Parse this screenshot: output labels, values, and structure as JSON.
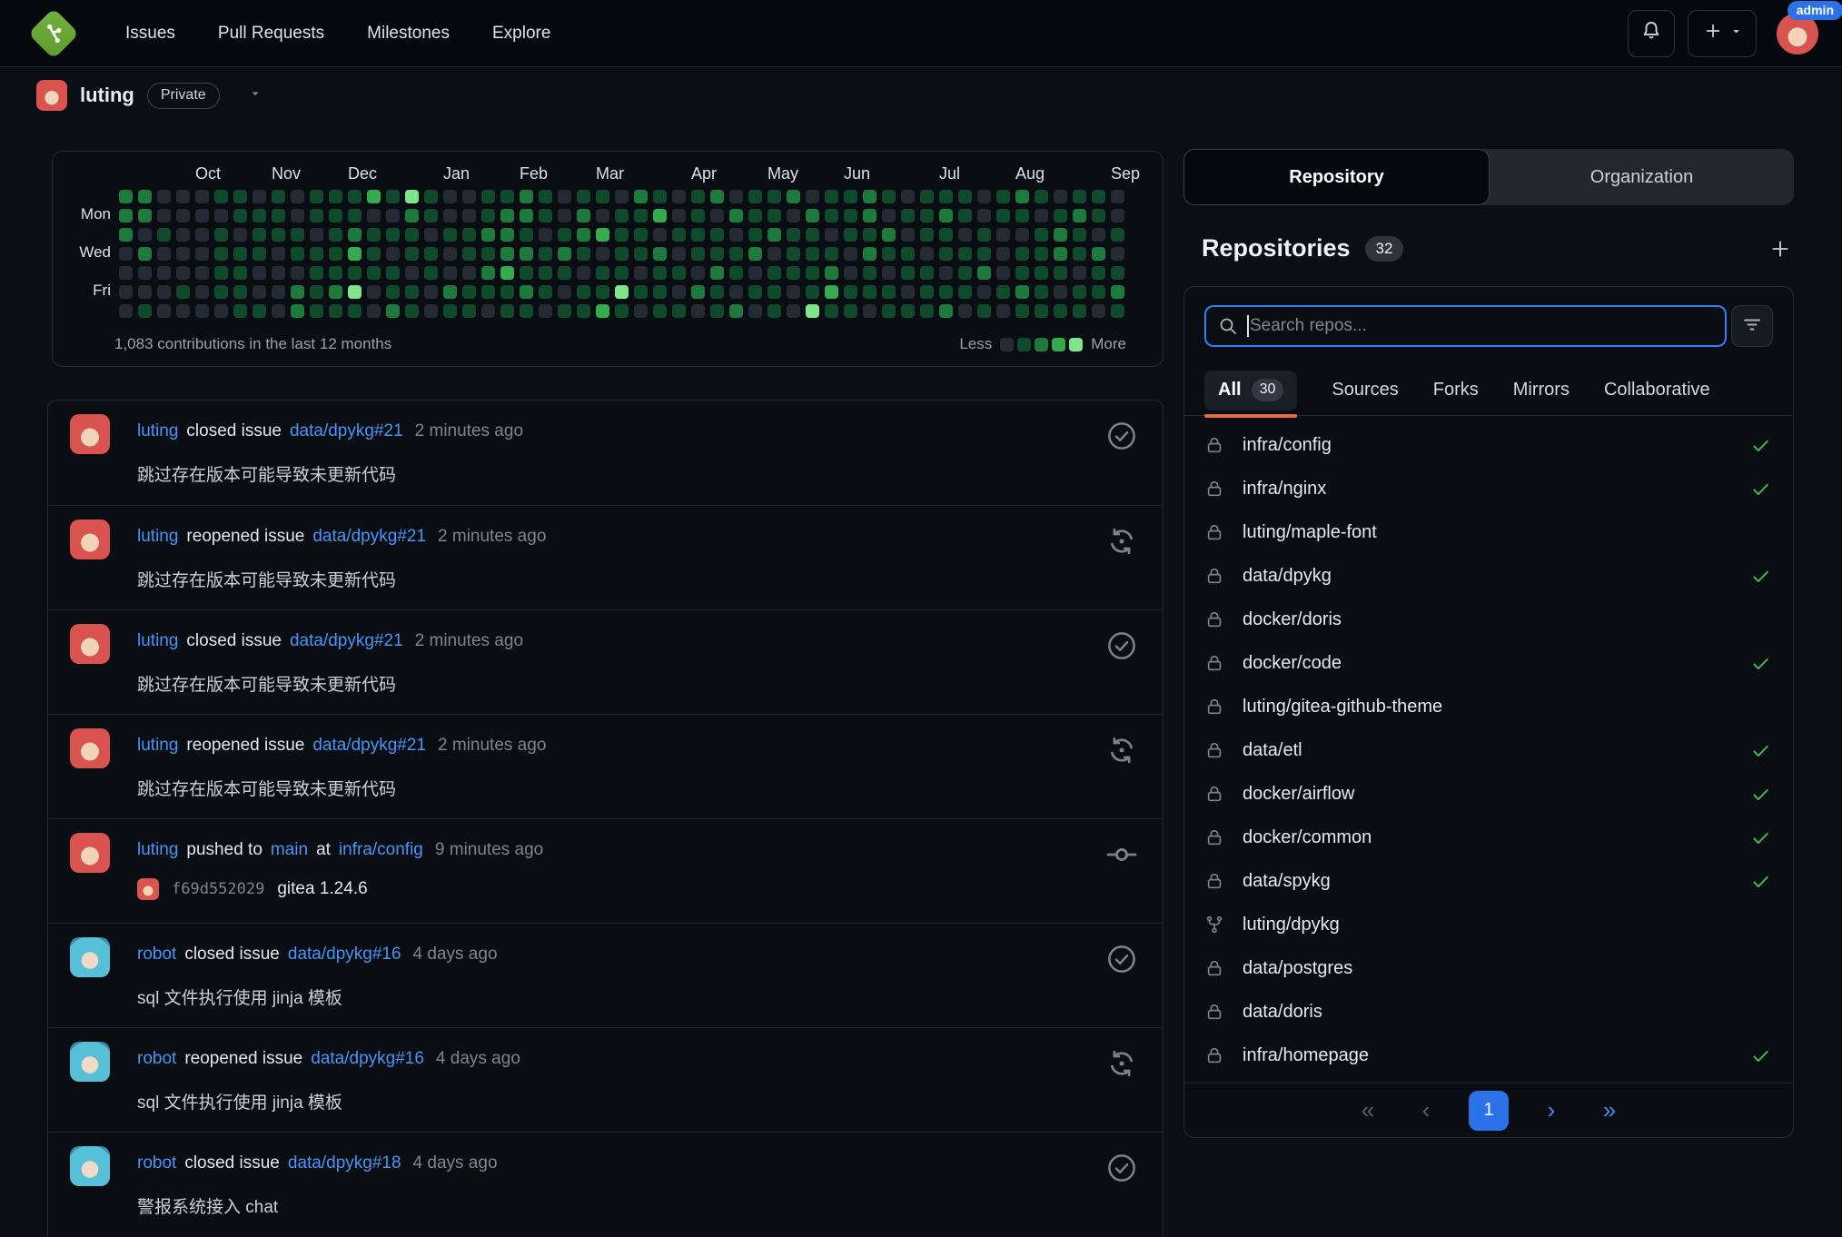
{
  "colors": {
    "accent_blue": "#4795f8",
    "active_page_blue": "#2b72e8",
    "check_green": "#3db954",
    "filter_underline": "#e5674e",
    "admin_badge_blue": "#2b72e8",
    "search_border_blue": "#2f81f7",
    "logo_green": "#68a63d",
    "heatmap_levels": [
      "#252b34",
      "#0f4a2c",
      "#1d7a3c",
      "#34ab4e",
      "#7ee58b"
    ]
  },
  "navbar": {
    "links": [
      "Issues",
      "Pull Requests",
      "Milestones",
      "Explore"
    ],
    "admin_badge": "admin",
    "icons": [
      "gitea-logo",
      "bell-icon",
      "plus-icon",
      "caret-down-icon",
      "avatar"
    ]
  },
  "profile": {
    "username": "luting",
    "visibility_badge": "Private"
  },
  "heatmap": {
    "contributions_text": "1,083 contributions in the last 12 months",
    "less_label": "Less",
    "more_label": "More",
    "day_labels": [
      {
        "label": "Mon",
        "row": 1
      },
      {
        "label": "Wed",
        "row": 3
      },
      {
        "label": "Fri",
        "row": 5
      }
    ],
    "months": [
      {
        "label": "Oct",
        "col": 4
      },
      {
        "label": "Nov",
        "col": 8
      },
      {
        "label": "Dec",
        "col": 12
      },
      {
        "label": "Jan",
        "col": 17
      },
      {
        "label": "Feb",
        "col": 21
      },
      {
        "label": "Mar",
        "col": 25
      },
      {
        "label": "Apr",
        "col": 30
      },
      {
        "label": "May",
        "col": 34
      },
      {
        "label": "Jun",
        "col": 38
      },
      {
        "label": "Jul",
        "col": 43
      },
      {
        "label": "Aug",
        "col": 47
      },
      {
        "label": "Sep",
        "col": 52
      }
    ],
    "rows": [
      "22000110101113141001121011021012011201121011101210110",
      "22000011101110021001221020113010211021120112101101210",
      "20100101110121110112210123110111012110112011010012101",
      "02000111011131011011221210112011120111021101110112120",
      "00000110001111101002311101101102101112010110120111011",
      "00010110021240110211121011411021011013111011101210112",
      "01000011021110210110110113101101201041101112010111101"
    ]
  },
  "feed": {
    "items": [
      {
        "user": "luting",
        "avatar": "luting",
        "action": "closed issue",
        "repo": "data/dpykg#21",
        "time": "2 minutes ago",
        "comment": "跳过存在版本可能导致未更新代码",
        "icon": "issue-closed"
      },
      {
        "user": "luting",
        "avatar": "luting",
        "action": "reopened issue",
        "repo": "data/dpykg#21",
        "time": "2 minutes ago",
        "comment": "跳过存在版本可能导致未更新代码",
        "icon": "issue-reopened"
      },
      {
        "user": "luting",
        "avatar": "luting",
        "action": "closed issue",
        "repo": "data/dpykg#21",
        "time": "2 minutes ago",
        "comment": "跳过存在版本可能导致未更新代码",
        "icon": "issue-closed"
      },
      {
        "user": "luting",
        "avatar": "luting",
        "action": "reopened issue",
        "repo": "data/dpykg#21",
        "time": "2 minutes ago",
        "comment": "跳过存在版本可能导致未更新代码",
        "icon": "issue-reopened"
      },
      {
        "user": "luting",
        "avatar": "luting",
        "action": "pushed to",
        "branch": "main",
        "at_label": "at",
        "repo": "infra/config",
        "time": "9 minutes ago",
        "icon": "commit",
        "commit": {
          "hash": "f69d552029",
          "message": "gitea 1.24.6"
        }
      },
      {
        "user": "robot",
        "avatar": "robot",
        "action": "closed issue",
        "repo": "data/dpykg#16",
        "time": "4 days ago",
        "comment": "sql 文件执行使用 jinja 模板",
        "icon": "issue-closed"
      },
      {
        "user": "robot",
        "avatar": "robot",
        "action": "reopened issue",
        "repo": "data/dpykg#16",
        "time": "4 days ago",
        "comment": "sql 文件执行使用 jinja 模板",
        "icon": "issue-reopened"
      },
      {
        "user": "robot",
        "avatar": "robot",
        "action": "closed issue",
        "repo": "data/dpykg#18",
        "time": "4 days ago",
        "comment": "警报系统接入 chat",
        "icon": "issue-closed"
      }
    ]
  },
  "panel": {
    "tabs": [
      {
        "label": "Repository",
        "active": true
      },
      {
        "label": "Organization",
        "active": false
      }
    ],
    "heading": "Repositories",
    "count": "32",
    "search_placeholder": "Search repos...",
    "filters": [
      {
        "label": "All",
        "count": "30",
        "active": true
      },
      {
        "label": "Sources"
      },
      {
        "label": "Forks"
      },
      {
        "label": "Mirrors"
      },
      {
        "label": "Collaborative"
      }
    ],
    "repos": [
      {
        "name": "infra/config",
        "icon": "lock",
        "check": true
      },
      {
        "name": "infra/nginx",
        "icon": "lock",
        "check": true
      },
      {
        "name": "luting/maple-font",
        "icon": "lock",
        "check": false
      },
      {
        "name": "data/dpykg",
        "icon": "lock",
        "check": true
      },
      {
        "name": "docker/doris",
        "icon": "lock",
        "check": false
      },
      {
        "name": "docker/code",
        "icon": "lock",
        "check": true
      },
      {
        "name": "luting/gitea-github-theme",
        "icon": "lock",
        "check": false
      },
      {
        "name": "data/etl",
        "icon": "lock",
        "check": true
      },
      {
        "name": "docker/airflow",
        "icon": "lock",
        "check": true
      },
      {
        "name": "docker/common",
        "icon": "lock",
        "check": true
      },
      {
        "name": "data/spykg",
        "icon": "lock",
        "check": true
      },
      {
        "name": "luting/dpykg",
        "icon": "fork",
        "check": false
      },
      {
        "name": "data/postgres",
        "icon": "lock",
        "check": false
      },
      {
        "name": "data/doris",
        "icon": "lock",
        "check": false
      },
      {
        "name": "infra/homepage",
        "icon": "lock",
        "check": true
      }
    ],
    "pagination": {
      "first": "«",
      "prev": "‹",
      "page": "1",
      "next": "›",
      "last": "»"
    }
  }
}
